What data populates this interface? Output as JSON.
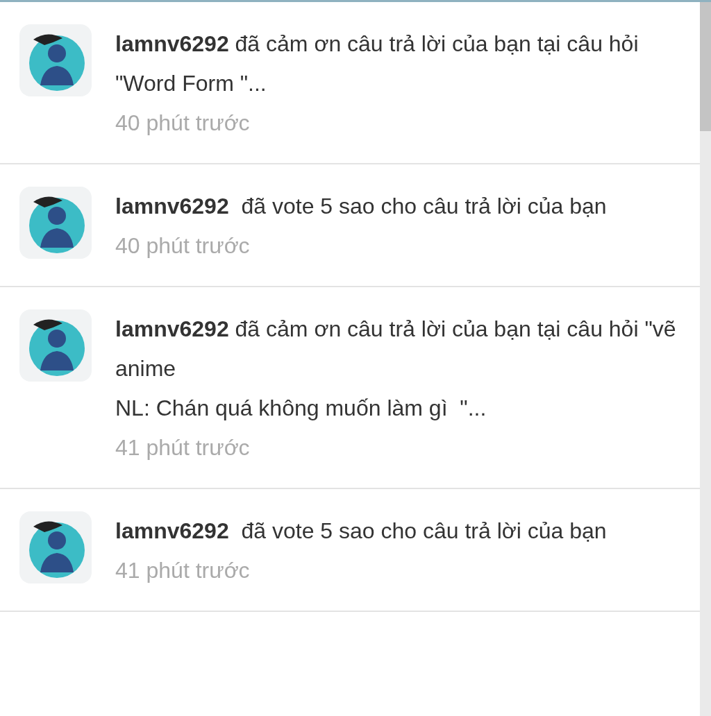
{
  "notifications": [
    {
      "message": "**lamnv6292** đã cảm ơn câu trả lời của bạn tại câu hỏi \"Word Form \"...",
      "time": "40 phút trước"
    },
    {
      "message": "**lamnv6292**  đã vote 5 sao cho câu trả lời của bạn",
      "time": "40 phút trước"
    },
    {
      "message": "**lamnv6292** đã cảm ơn câu trả lời của bạn tại câu hỏi \"vẽ anime\nNL: Chán quá không muốn làm gì  \"...",
      "time": "41 phút trước"
    },
    {
      "message": "**lamnv6292**  đã vote 5 sao cho câu trả lời của bạn",
      "time": "41 phút trước"
    }
  ]
}
